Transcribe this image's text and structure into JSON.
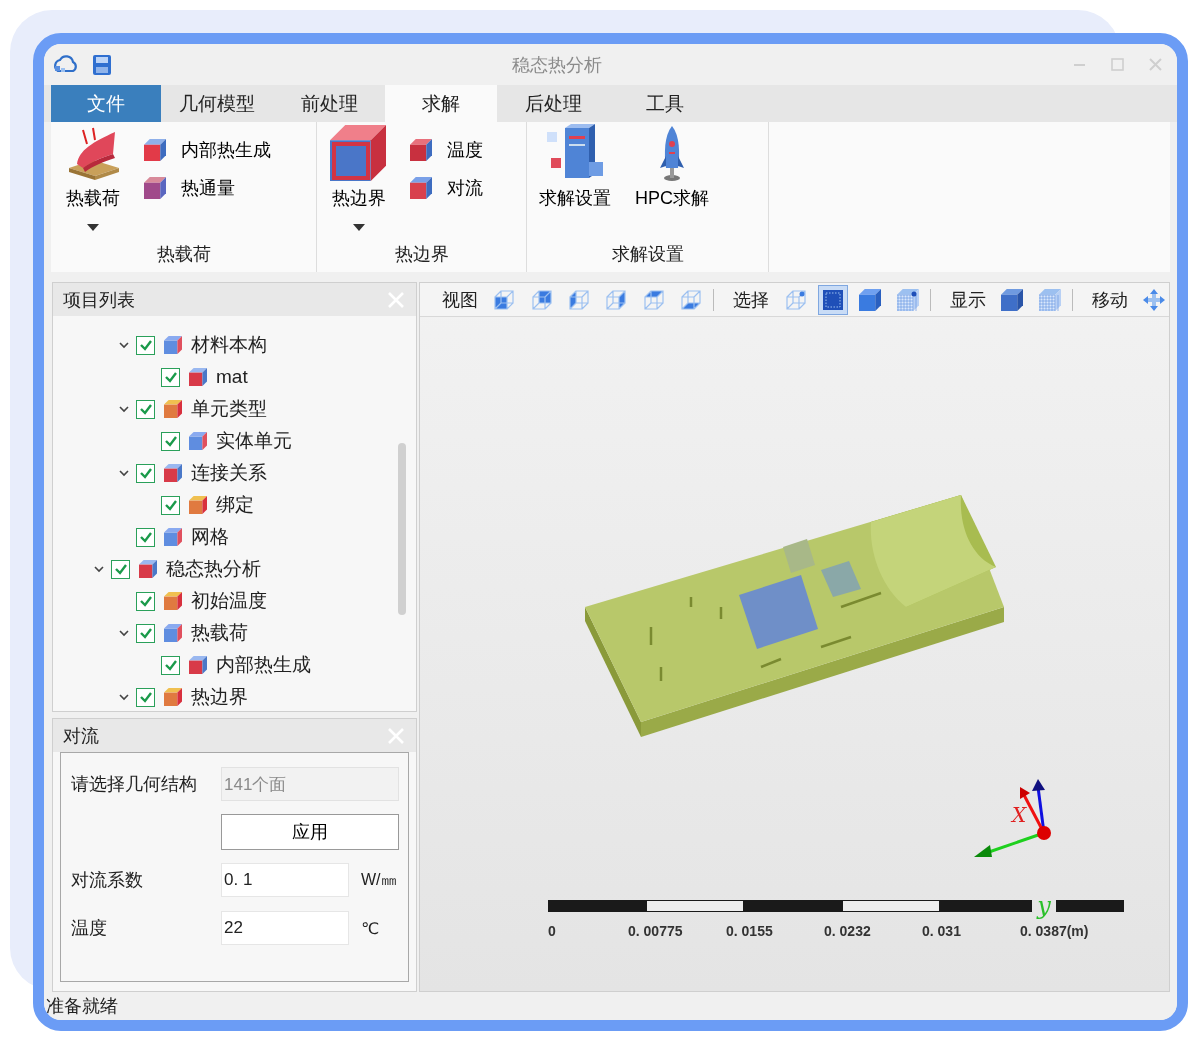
{
  "window": {
    "title": "稳态热分析"
  },
  "tabs": [
    {
      "label": "文件",
      "kind": "file",
      "selected": false
    },
    {
      "label": "几何模型",
      "kind": "tab",
      "selected": false
    },
    {
      "label": "前处理",
      "kind": "tab",
      "selected": false
    },
    {
      "label": "求解",
      "kind": "tab",
      "selected": true
    },
    {
      "label": "后处理",
      "kind": "tab",
      "selected": false
    },
    {
      "label": "工具",
      "kind": "tab",
      "selected": false
    }
  ],
  "ribbon": {
    "groups": [
      {
        "title": "热载荷",
        "items": [
          {
            "label": "热载荷",
            "kind": "large",
            "dropdown": true
          },
          {
            "label": "内部热生成",
            "kind": "small"
          },
          {
            "label": "热通量",
            "kind": "small"
          }
        ]
      },
      {
        "title": "热边界",
        "items": [
          {
            "label": "热边界",
            "kind": "large",
            "dropdown": true
          },
          {
            "label": "温度",
            "kind": "small"
          },
          {
            "label": "对流",
            "kind": "small"
          }
        ]
      },
      {
        "title": "求解设置",
        "items": [
          {
            "label": "求解设置",
            "kind": "large",
            "dropdown": false
          },
          {
            "label": "HPC求解",
            "kind": "large",
            "dropdown": false
          }
        ]
      }
    ]
  },
  "project_panel": {
    "title": "项目列表",
    "tree": [
      {
        "children": [
          {
            "label": "材料本构",
            "checked": true,
            "expanded": true,
            "children": [
              {
                "label": "mat",
                "checked": true
              }
            ]
          },
          {
            "label": "单元类型",
            "checked": true,
            "expanded": true,
            "children": [
              {
                "label": "实体单元",
                "checked": true
              }
            ]
          },
          {
            "label": "连接关系",
            "checked": true,
            "expanded": true,
            "children": [
              {
                "label": "绑定",
                "checked": true
              }
            ]
          },
          {
            "label": "网格",
            "checked": true
          }
        ]
      },
      {
        "label": "稳态热分析",
        "checked": true,
        "expanded": true,
        "children": [
          {
            "label": "初始温度",
            "checked": true
          },
          {
            "label": "热载荷",
            "checked": true,
            "expanded": true,
            "children": [
              {
                "label": "内部热生成",
                "checked": true
              }
            ]
          },
          {
            "label": "热边界",
            "checked": true,
            "expanded": true
          }
        ]
      }
    ]
  },
  "convection_panel": {
    "title": "对流",
    "selection": {
      "label": "请选择几何结构",
      "value": "141个面",
      "disabled": true
    },
    "apply_button": "应用",
    "fields": [
      {
        "label": "对流系数",
        "value": "0. 1",
        "unit": "W/㎜"
      },
      {
        "label": "温度",
        "value": "22",
        "unit": "℃"
      }
    ]
  },
  "viewport": {
    "toolbar": [
      {
        "label": "视图",
        "buttons": [
          {
            "selected": false
          },
          {
            "selected": false
          },
          {
            "selected": false
          },
          {
            "selected": false
          },
          {
            "selected": false
          },
          {
            "selected": false
          }
        ]
      },
      {
        "label": "选择",
        "buttons": [
          {
            "selected": false
          },
          {
            "selected": true
          },
          {
            "selected": false
          },
          {
            "selected": false
          }
        ]
      },
      {
        "label": "显示",
        "buttons": [
          {
            "selected": false
          },
          {
            "selected": false
          }
        ]
      },
      {
        "label": "移动",
        "buttons": [
          {
            "selected": false
          }
        ]
      }
    ],
    "scale_bar": {
      "labels": [
        "0",
        "0. 00775",
        "0. 0155",
        "0. 0232",
        "0. 031",
        "0. 0387(m)"
      ]
    },
    "axes": {
      "x_label": "X",
      "y_label": "y"
    }
  },
  "status_bar": {
    "text": "准备就绪"
  }
}
